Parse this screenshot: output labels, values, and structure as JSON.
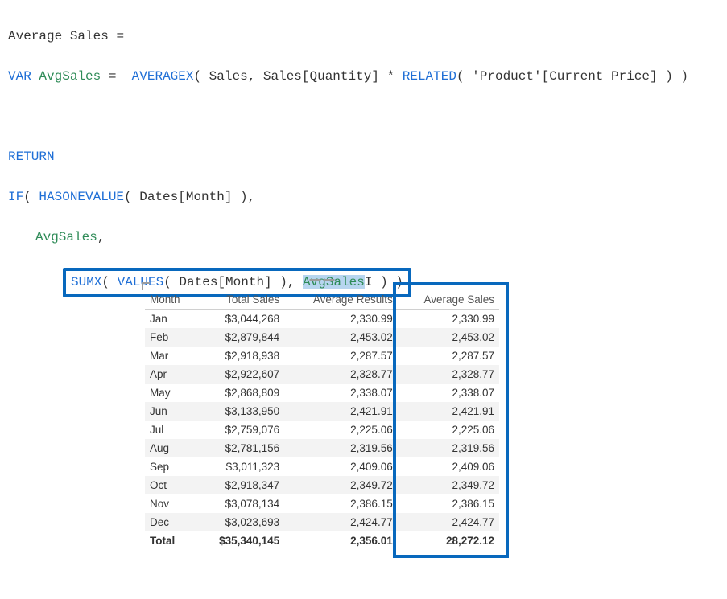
{
  "formula": {
    "measure_name": "Average Sales",
    "equals": "=",
    "var_kw": "VAR",
    "var_name": "AvgSales",
    "averagex": "AVERAGEX",
    "sales_tbl": "Sales",
    "sales_qty": "Sales[Quantity]",
    "mult": "*",
    "related": "RELATED",
    "product_price": "'Product'[Current Price]",
    "return_kw": "RETURN",
    "if_fn": "IF",
    "hasonevalue": "HASONEVALUE",
    "dates_month": "Dates[Month]",
    "sumx": "SUMX",
    "values_fn": "VALUES",
    "hl_caret": "|"
  },
  "table": {
    "headers": {
      "month": "Month",
      "total_sales": "Total Sales",
      "avg_results": "Average Results",
      "avg_sales": "Average Sales"
    },
    "rows": [
      {
        "month": "Jan",
        "total": "$3,044,268",
        "avg_r": "2,330.99",
        "avg_s": "2,330.99"
      },
      {
        "month": "Feb",
        "total": "$2,879,844",
        "avg_r": "2,453.02",
        "avg_s": "2,453.02"
      },
      {
        "month": "Mar",
        "total": "$2,918,938",
        "avg_r": "2,287.57",
        "avg_s": "2,287.57"
      },
      {
        "month": "Apr",
        "total": "$2,922,607",
        "avg_r": "2,328.77",
        "avg_s": "2,328.77"
      },
      {
        "month": "May",
        "total": "$2,868,809",
        "avg_r": "2,338.07",
        "avg_s": "2,338.07"
      },
      {
        "month": "Jun",
        "total": "$3,133,950",
        "avg_r": "2,421.91",
        "avg_s": "2,421.91"
      },
      {
        "month": "Jul",
        "total": "$2,759,076",
        "avg_r": "2,225.06",
        "avg_s": "2,225.06"
      },
      {
        "month": "Aug",
        "total": "$2,781,156",
        "avg_r": "2,319.56",
        "avg_s": "2,319.56"
      },
      {
        "month": "Sep",
        "total": "$3,011,323",
        "avg_r": "2,409.06",
        "avg_s": "2,409.06"
      },
      {
        "month": "Oct",
        "total": "$2,918,347",
        "avg_r": "2,349.72",
        "avg_s": "2,349.72"
      },
      {
        "month": "Nov",
        "total": "$3,078,134",
        "avg_r": "2,386.15",
        "avg_s": "2,386.15"
      },
      {
        "month": "Dec",
        "total": "$3,023,693",
        "avg_r": "2,424.77",
        "avg_s": "2,424.77"
      }
    ],
    "total_row": {
      "label": "Total",
      "total": "$35,340,145",
      "avg_r": "2,356.01",
      "avg_s": "28,272.12"
    }
  }
}
